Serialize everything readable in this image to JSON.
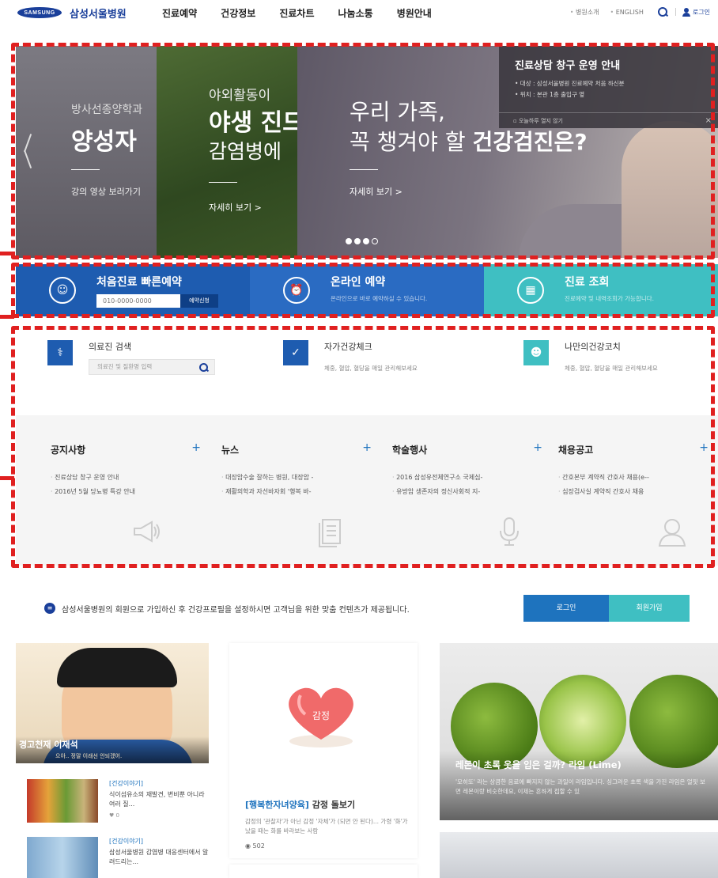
{
  "header": {
    "samsung_logo": "SAMSUNG",
    "hospital_name": "삼성서울병원",
    "nav": [
      "진료예약",
      "건강정보",
      "진료차트",
      "나눔소통",
      "병원안내"
    ],
    "util": [
      "병원소개",
      "ENGLISH"
    ],
    "login": "로그인"
  },
  "hero": {
    "slide1": {
      "sub": "방사선종양학과",
      "title": "양성자",
      "link": "강의 영상 보러가기"
    },
    "slide2": {
      "sub": "야외활동이",
      "title": "야생 진드",
      "title2": "감염병에",
      "link": "자세히 보기 >"
    },
    "slide3": {
      "line1": "우리 가족,",
      "line2_pre": "꼭 챙겨야 할",
      "line2_bold": "건강검진은?",
      "link": "자세히 보기 >"
    },
    "popup": {
      "title": "진료상담 창구 운영 안내",
      "lines": [
        "• 대상 : 삼성서울병원 진료예약 처음 하신분",
        "• 위치 : 본관 1층 출입구 옆"
      ],
      "close_today": "오늘하루 열지 않기",
      "close_x": "×"
    }
  },
  "quick": {
    "q1": {
      "title": "처음진료 빠른예약",
      "input_value": "010-0000-0000",
      "button": "예약신청"
    },
    "q2": {
      "title": "온라인 예약",
      "sub": "온라인으로 바로 예약하실 수 있습니다."
    },
    "q3": {
      "title": "진료 조회",
      "sub": "진료예약 및 내역조회가 가능합니다."
    }
  },
  "tools": {
    "t1": {
      "title": "의료진 검색",
      "placeholder": "의료진 및 질환명 입력"
    },
    "t2": {
      "title": "자가건강체크",
      "sub": "체중, 혈압, 혈당을 매일 관리해보세요"
    },
    "t3": {
      "title": "나만의건강코치",
      "sub": "체중, 혈압, 혈당을 매일 관리해보세요"
    }
  },
  "boards": [
    {
      "title": "공지사항",
      "items": [
        "진료상담 창구 운영 안내",
        "2016년 5월 당뇨병 특강 안내"
      ]
    },
    {
      "title": "뉴스",
      "items": [
        "대장암수술 잘하는 병원, 대장암 -",
        "재활의학과 자선바자회 '행복 바-"
      ]
    },
    {
      "title": "학술행사",
      "items": [
        "2016 삼성유전체연구소 국제심-",
        "유방암 생존자의 정신사회적 지-"
      ]
    },
    {
      "title": "채용공고",
      "items": [
        "간호본부 계약직 간호사 채용(e--",
        "심장검사실 계약직 간호사 채용"
      ]
    }
  ],
  "plus": "+",
  "member": {
    "text": "삼성서울병원의 회원으로 가입하신 후 건강프로필을 설정하시면 고객님을 위한 맞춤 컨텐츠가 제공됩니다.",
    "login": "로그인",
    "join": "회원가입"
  },
  "cards": {
    "comic": {
      "title": "경고천재 이재석",
      "sub": "으아.. 정말 이래선 안되겠어."
    },
    "news1": {
      "tag": "[건강이야기]",
      "desc": "식이섬유소의 재발견, 변비뿐 아니라 여러 질...",
      "views": "♥ 0"
    },
    "news2": {
      "tag": "[건강이야기]",
      "desc": "삼성서울병원 감염병 대응센터에서 알려드리는..."
    },
    "feature": {
      "heart_text": "감정",
      "title_tag": "[행복한자녀양육]",
      "title": " 감정 돌보기",
      "desc": "감정의 '관찰자'가 아닌 감정 '자체'가 (되면 안 된다)... 가령 '화'가 났을 때는 화를 바라보는 사람",
      "views": "502"
    },
    "lime": {
      "title": "레몬이 초록 옷을 입은 걸까? 라임 (Lime)",
      "desc": "'모히또' 라는 상큼한 음료에 빠지지 않는 과일이 라임입니다. 싱그러운 초록 색을 가진 라임은 얼핏 보면 레몬이랑 비슷한데요, 이제는 흔하게 접할 수 있"
    }
  },
  "colors": {
    "brand": "#1a3f9a",
    "accent_blue": "#1e73be",
    "teal": "#3fbfc2",
    "annotation": "#e02020"
  }
}
